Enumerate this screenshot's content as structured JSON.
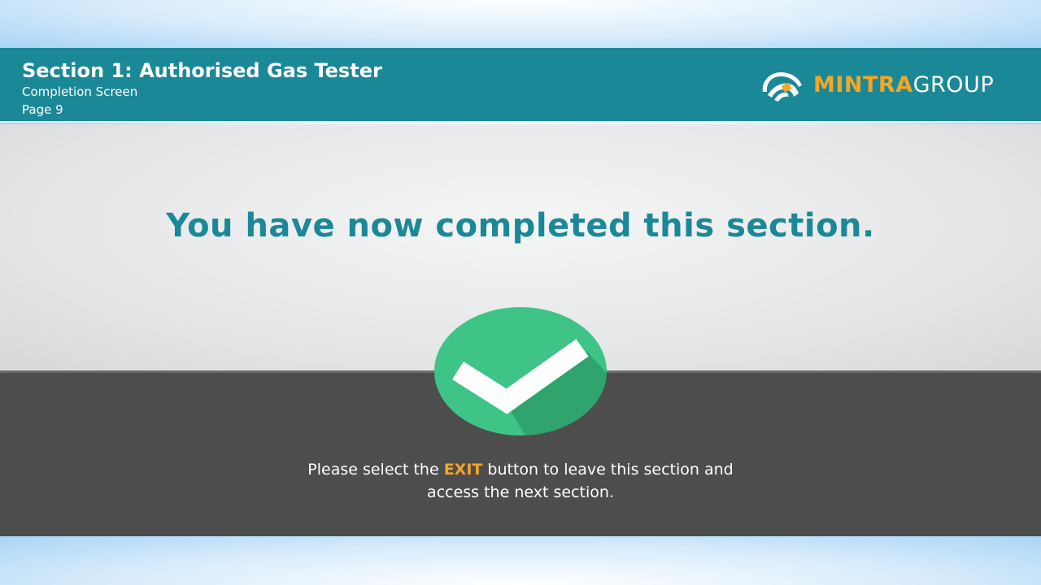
{
  "header": {
    "title": "Section 1: Authorised Gas Tester",
    "subtitle": "Completion Screen",
    "page": "Page 9"
  },
  "logo": {
    "icon": "mintra-hand-logo-icon",
    "part1": "MINTRA",
    "part2": "GROUP"
  },
  "main": {
    "headline": "You have now completed this section.",
    "check_icon": "checkmark-circle-icon",
    "message_before": "Please select the ",
    "message_exit": "EXIT",
    "message_line1_after": " button to leave this section and",
    "message_line2": "access the next section."
  },
  "colors": {
    "teal": "#1b8898",
    "orange": "#f5a623",
    "green": "#3ec487",
    "dark_panel": "#4d4d4d"
  }
}
